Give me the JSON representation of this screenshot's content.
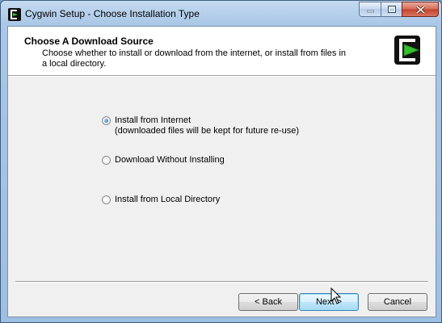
{
  "window": {
    "title": "Cygwin Setup - Choose Installation Type"
  },
  "header": {
    "title": "Choose A Download Source",
    "description": "Choose whether to install or download from the internet, or install from files in a local directory."
  },
  "options": [
    {
      "label": "Install from Internet",
      "sublabel": "(downloaded files will be kept for future re-use)",
      "checked": true
    },
    {
      "label": "Download Without Installing",
      "sublabel": "",
      "checked": false
    },
    {
      "label": "Install from Local Directory",
      "sublabel": "",
      "checked": false
    }
  ],
  "buttons": {
    "back": "< Back",
    "next": "Next >",
    "cancel": "Cancel"
  },
  "icons": {
    "app": "cygwin-logo-icon",
    "header_logo": "cygwin-logo-icon",
    "minimize": "minimize-icon",
    "maximize": "maximize-icon",
    "close": "close-icon",
    "cursor": "mouse-pointer-icon"
  },
  "colors": {
    "logo_green": "#35c12b",
    "close_red": "#c2432c",
    "default_button": "#3c7fb1"
  }
}
